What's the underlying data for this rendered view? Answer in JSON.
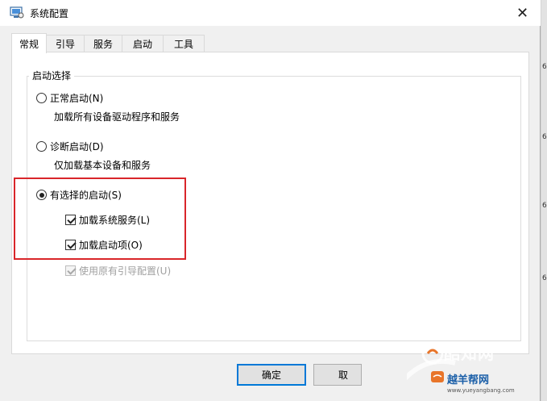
{
  "window": {
    "title": "系统配置",
    "close_glyph": "✕"
  },
  "tabs": [
    {
      "label": "常规",
      "active": true
    },
    {
      "label": "引导",
      "active": false
    },
    {
      "label": "服务",
      "active": false
    },
    {
      "label": "启动",
      "active": false
    },
    {
      "label": "工具",
      "active": false
    }
  ],
  "startup": {
    "group_label": "启动选择",
    "normal": {
      "label": "正常启动(N)",
      "description": "加载所有设备驱动程序和服务",
      "selected": false
    },
    "diagnostic": {
      "label": "诊断启动(D)",
      "description": "仅加载基本设备和服务",
      "selected": false
    },
    "selective": {
      "label": "有选择的启动(S)",
      "selected": true,
      "options": [
        {
          "label": "加载系统服务(L)",
          "checked": true,
          "enabled": true
        },
        {
          "label": "加载启动项(O)",
          "checked": true,
          "enabled": true
        },
        {
          "label": "使用原有引导配置(U)",
          "checked": true,
          "enabled": false
        }
      ]
    }
  },
  "buttons": {
    "ok": "确定",
    "cancel": "取"
  },
  "background_strip": [
    "6",
    "6",
    "6",
    "6"
  ],
  "watermark": {
    "brand": "酷知网",
    "sub": "越羊帮网",
    "url": "www.yueyangbang.com"
  },
  "colors": {
    "highlight": "#d9262a",
    "default_button_border": "#0078d7"
  }
}
